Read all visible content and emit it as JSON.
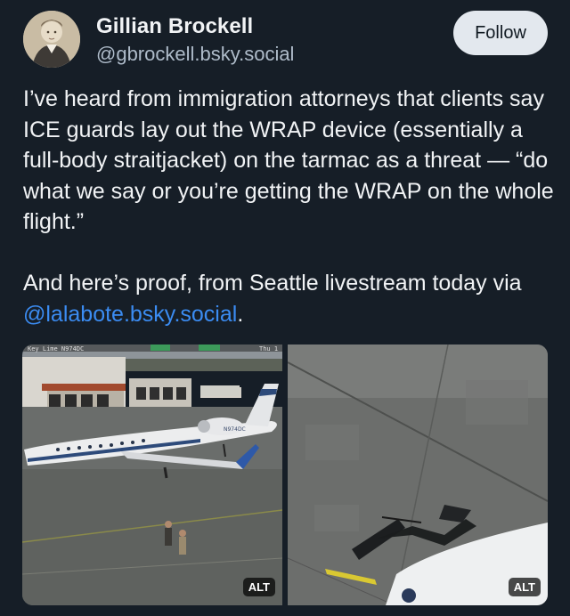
{
  "author": {
    "display_name": "Gillian Brockell",
    "handle": "@gbrockell.bsky.social"
  },
  "follow_button": {
    "label": "Follow"
  },
  "post": {
    "paragraph1": "I’ve heard from immigration attorneys that clients say ICE guards lay out the WRAP device (essentially a full-body straitjacket) on the tarmac as a threat — “do what we say or you’re getting the WRAP on the whole flight.”",
    "paragraph2_prefix": "And here’s proof, from Seattle livestream today via ",
    "mention": "@lalabote.bsky.social",
    "paragraph2_suffix": "."
  },
  "images": [
    {
      "alt_badge": "ALT",
      "overlay_text": "Key Lime N974DC",
      "overlay_right": "Thu 1",
      "tail_number": "N974DC"
    },
    {
      "alt_badge": "ALT"
    }
  ],
  "colors": {
    "background": "#161e27",
    "link": "#3b8cf2",
    "follow_bg": "#e3e8ee"
  }
}
